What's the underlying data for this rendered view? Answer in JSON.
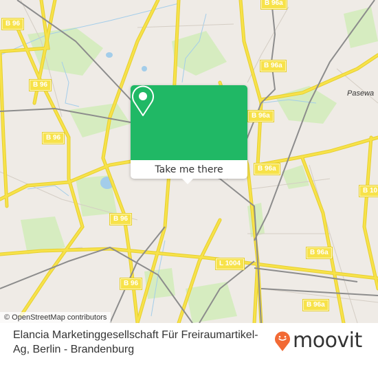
{
  "map": {
    "attribution": "© OpenStreetMap contributors",
    "road_labels": [
      {
        "id": "b96-top-left",
        "text": "B 96"
      },
      {
        "id": "b96-left-mid",
        "text": "B 96"
      },
      {
        "id": "b96-left-upper",
        "text": "B 96"
      },
      {
        "id": "b96-center-left",
        "text": "B 96"
      },
      {
        "id": "b96-lower-left",
        "text": "B 96"
      },
      {
        "id": "b96-bottom",
        "text": "96"
      },
      {
        "id": "b96a-top",
        "text": "B 96a"
      },
      {
        "id": "b96a-upper-right",
        "text": "B 96a"
      },
      {
        "id": "b96a-right",
        "text": "B 96a"
      },
      {
        "id": "b96a-mid-right",
        "text": "B 96a"
      },
      {
        "id": "b96a-lower-right",
        "text": "B 96a"
      },
      {
        "id": "b96a-bottom-right",
        "text": "B 96a"
      },
      {
        "id": "b10-right",
        "text": "B 10"
      },
      {
        "id": "l1004",
        "text": "L 1004"
      }
    ],
    "place_labels": [
      {
        "id": "pasewalk",
        "text": "Pasewa"
      }
    ],
    "colors": {
      "background": "#efebe6",
      "major_road": "#f7e24a",
      "rail": "#8c8c8c",
      "park": "#d6ecc0",
      "water": "#a3cdea"
    }
  },
  "popup": {
    "pin_icon": "location-pin-icon",
    "cta_label": "Take me there",
    "accent": "#20b865"
  },
  "footer": {
    "title": "Elancia Marketinggesellschaft Für Freiraumartikel-Ag, Berlin - Brandenburg",
    "logo_text": "moovit",
    "logo_icon": "moovit-pin-icon",
    "logo_color": "#f26a35"
  }
}
